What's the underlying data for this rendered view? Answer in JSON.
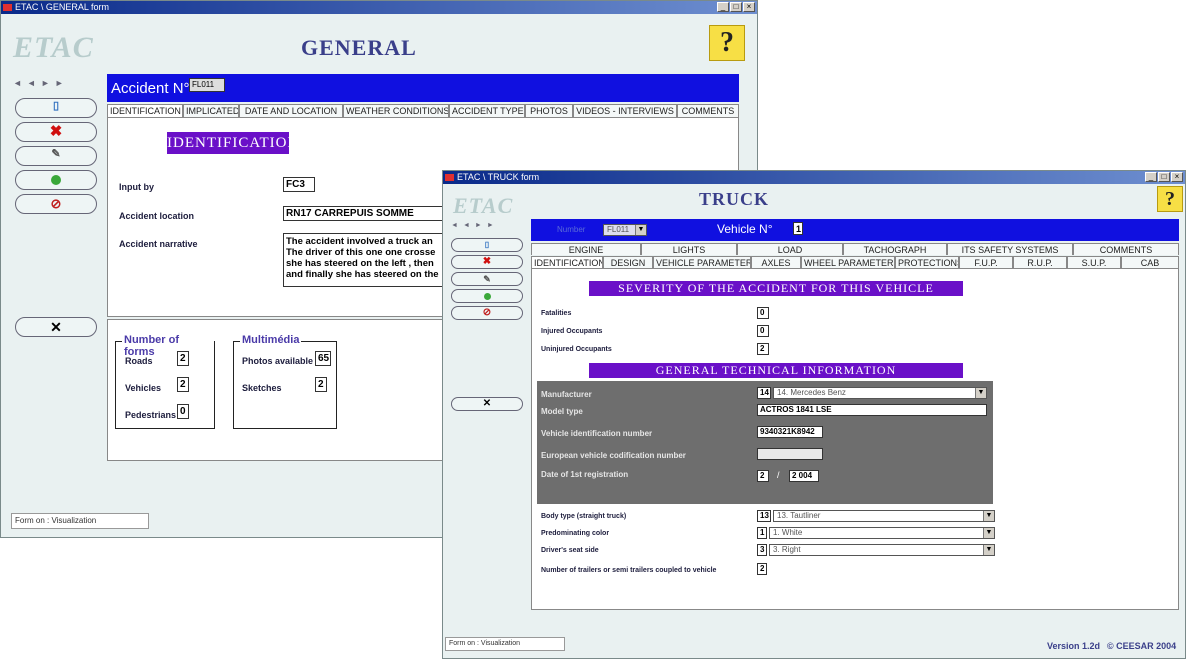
{
  "general": {
    "title": "ETAC \\ GENERAL form",
    "logo": "ETAC",
    "heading": "GENERAL",
    "help": "?",
    "accident_label": "Accident N°",
    "accident_no": "FL011",
    "tabs": [
      "IDENTIFICATION",
      "IMPLICATED",
      "DATE AND LOCATION",
      "WEATHER CONDITIONS",
      "ACCIDENT TYPE",
      "PHOTOS",
      "VIDEOS - INTERVIEWS",
      "COMMENTS"
    ],
    "section_title": "IDENTIFICATION",
    "input_by_label": "Input by",
    "input_by": "FC3",
    "location_label": "Accident location",
    "location": "RN17 CARREPUIS SOMME",
    "narrative_label": "Accident narrative",
    "narrative": "The accident involved a truck an The driver of this one one crosse she has steered on the left , then and finally she has steered on the",
    "forms_group": "Number of forms",
    "roads_label": "Roads",
    "roads": "2",
    "vehicles_label": "Vehicles",
    "vehicles": "2",
    "pedestrians_label": "Pedestrians",
    "pedestrians": "0",
    "media_group": "Multimédia",
    "photos_label": "Photos available",
    "photos": "65",
    "sketches_label": "Sketches",
    "sketches": "2",
    "status": "Form on : Visualization"
  },
  "truck": {
    "title": "ETAC \\ TRUCK form",
    "logo": "ETAC",
    "heading": "TRUCK",
    "help": "?",
    "number_label": "Number",
    "number_value": "FL011",
    "vehicle_label": "Vehicle N°",
    "vehicle_no": "1",
    "tabs_top": [
      "ENGINE",
      "LIGHTS",
      "LOAD",
      "TACHOGRAPH",
      "ITS SAFETY SYSTEMS",
      "COMMENTS"
    ],
    "tabs_bottom": [
      "IDENTIFICATION",
      "DESIGN",
      "VEHICLE PARAMETERS",
      "AXLES",
      "WHEEL PARAMETERS",
      "PROTECTIONS",
      "F.U.P.",
      "R.U.P.",
      "S.U.P.",
      "CAB"
    ],
    "severity_title": "SEVERITY OF THE ACCIDENT FOR THIS VEHICLE",
    "fatalities_label": "Fatalities",
    "fatalities": "0",
    "injured_label": "Injured Occupants",
    "injured": "0",
    "uninjured_label": "Uninjured Occupants",
    "uninjured": "2",
    "tech_title": "GENERAL TECHNICAL INFORMATION",
    "manufacturer_label": "Manufacturer",
    "manufacturer_code": "14",
    "manufacturer": "14. Mercedes Benz",
    "model_label": "Model type",
    "model": "ACTROS 1841 LSE",
    "vin_label": "Vehicle identification number",
    "vin": "9340321K8942",
    "eu_code_label": "European vehicle codification number",
    "eu_code": "",
    "reg_label": "Date of 1st registration",
    "reg_month": "2",
    "reg_sep": "/",
    "reg_year": "2 004",
    "body_label": "Body type (straight truck)",
    "body_code": "13",
    "body": "13. Tautliner",
    "color_label": "Predominating color",
    "color_code": "1",
    "color": "1. White",
    "seat_label": "Driver's seat side",
    "seat_code": "3",
    "seat": "3. Right",
    "trailers_label": "Number of trailers or semi trailers coupled to vehicle",
    "trailers": "2",
    "status": "Form on : Visualization",
    "version": "Version 1.2d",
    "copyright": "© CEESAR 2004"
  }
}
